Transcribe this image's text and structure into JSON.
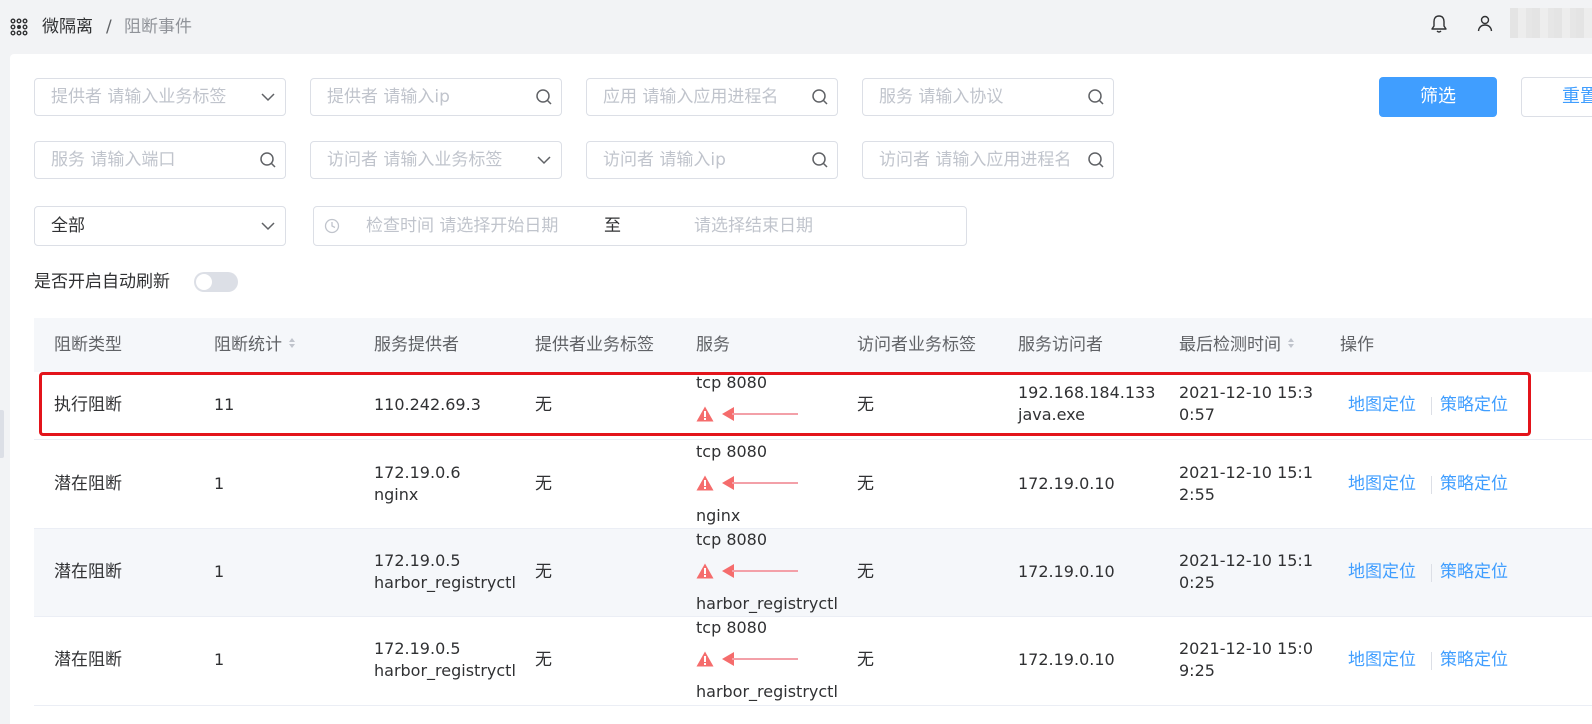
{
  "breadcrumb": {
    "app": "微隔离",
    "separator": "/",
    "current": "阻断事件"
  },
  "filters": {
    "provider_tag_placeholder": "提供者 请输入业务标签",
    "provider_ip_placeholder": "提供者 请输入ip",
    "app_process_placeholder": "应用 请输入应用进程名",
    "service_protocol_placeholder": "服务 请输入协议",
    "service_port_placeholder": "服务 请输入端口",
    "visitor_tag_placeholder": "访问者 请输入业务标签",
    "visitor_ip_placeholder": "访问者 请输入ip",
    "visitor_process_placeholder": "访问者 请输入应用进程名",
    "type_select_value": "全部",
    "date_start_placeholder": "检查时间 请选择开始日期",
    "date_separator": "至",
    "date_end_placeholder": "请选择结束日期",
    "filter_button": "筛选",
    "reset_button": "重置",
    "auto_refresh_label": "是否开启自动刷新"
  },
  "table": {
    "headers": {
      "type": "阻断类型",
      "count": "阻断统计",
      "provider": "服务提供者",
      "provider_tag": "提供者业务标签",
      "service": "服务",
      "visitor_tag": "访问者业务标签",
      "visitor": "服务访问者",
      "last_time": "最后检测时间",
      "actions": "操作"
    },
    "rows": [
      {
        "type": "执行阻断",
        "count": "11",
        "provider_ip": "110.242.69.3",
        "provider_name": "",
        "provider_tag": "无",
        "service": "tcp  8080",
        "service_process": "",
        "visitor_tag": "无",
        "visitor_ip": "192.168.184.133",
        "visitor_name": "java.exe",
        "time_line1": "2021-12-10 15:3",
        "time_line2": "0:57",
        "action_map": "地图定位",
        "action_policy": "策略定位"
      },
      {
        "type": "潜在阻断",
        "count": "1",
        "provider_ip": "172.19.0.6",
        "provider_name": "nginx",
        "provider_tag": "无",
        "service": "tcp  8080",
        "service_process": "nginx",
        "visitor_tag": "无",
        "visitor_ip": "172.19.0.10",
        "visitor_name": "",
        "time_line1": "2021-12-10 15:1",
        "time_line2": "2:55",
        "action_map": "地图定位",
        "action_policy": "策略定位"
      },
      {
        "type": "潜在阻断",
        "count": "1",
        "provider_ip": "172.19.0.5",
        "provider_name": "harbor_registryctl",
        "provider_tag": "无",
        "service": "tcp  8080",
        "service_process": "harbor_registryctl",
        "visitor_tag": "无",
        "visitor_ip": "172.19.0.10",
        "visitor_name": "",
        "time_line1": "2021-12-10 15:1",
        "time_line2": "0:25",
        "action_map": "地图定位",
        "action_policy": "策略定位"
      },
      {
        "type": "潜在阻断",
        "count": "1",
        "provider_ip": "172.19.0.5",
        "provider_name": "harbor_registryctl",
        "provider_tag": "无",
        "service": "tcp  8080",
        "service_process": "harbor_registryctl",
        "visitor_tag": "无",
        "visitor_ip": "172.19.0.10",
        "visitor_name": "",
        "time_line1": "2021-12-10 15:0",
        "time_line2": "9:25",
        "action_map": "地图定位",
        "action_policy": "策略定位"
      }
    ]
  },
  "colors": {
    "primary": "#409eff",
    "highlight_border": "#e3141b",
    "warning": "#f56c6c",
    "arrow": "#f3a0a8"
  }
}
